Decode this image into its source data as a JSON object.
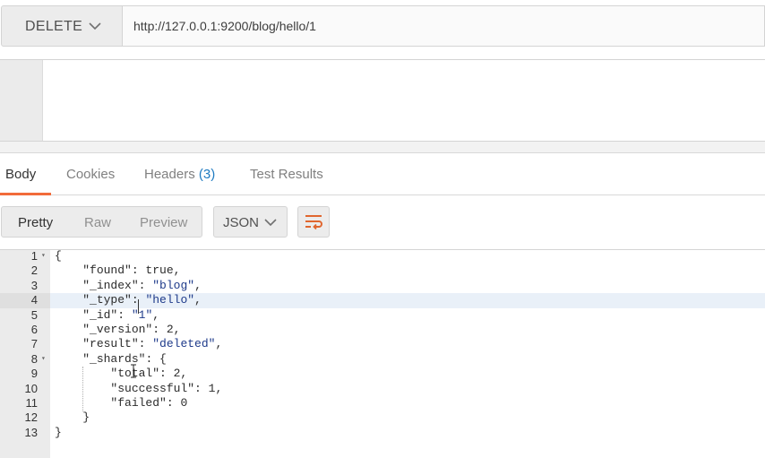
{
  "request": {
    "method": "DELETE",
    "url": "http://127.0.0.1:9200/blog/hello/1"
  },
  "response_tabs": [
    {
      "label": "Body",
      "active": true
    },
    {
      "label": "Cookies"
    },
    {
      "label": "Headers",
      "count": "(3)"
    },
    {
      "label": "Test Results"
    }
  ],
  "view_modes": [
    "Pretty",
    "Raw",
    "Preview"
  ],
  "active_view": "Pretty",
  "format": "JSON",
  "icons": {
    "method_dropdown": "chevron-down-icon",
    "format_dropdown": "chevron-down-icon",
    "wrap": "wrap-lines-icon"
  },
  "colors": {
    "accent": "#f26b3a",
    "count": "#1f7bc1",
    "string": "#1e3a8a"
  },
  "code_lines": [
    {
      "n": "1",
      "text": "{"
    },
    {
      "n": "2",
      "text": "    \"found\": true,"
    },
    {
      "n": "3",
      "text": "    \"_index\": \"blog\","
    },
    {
      "n": "4",
      "text": "    \"_type\": \"hello\","
    },
    {
      "n": "5",
      "text": "    \"_id\": \"1\","
    },
    {
      "n": "6",
      "text": "    \"_version\": 2,"
    },
    {
      "n": "7",
      "text": "    \"result\": \"deleted\","
    },
    {
      "n": "8",
      "text": "    \"_shards\": {"
    },
    {
      "n": "9",
      "text": "        \"total\": 2,"
    },
    {
      "n": "10",
      "text": "        \"successful\": 1,"
    },
    {
      "n": "11",
      "text": "        \"failed\": 0"
    },
    {
      "n": "12",
      "text": "    }"
    },
    {
      "n": "13",
      "text": "}"
    }
  ]
}
